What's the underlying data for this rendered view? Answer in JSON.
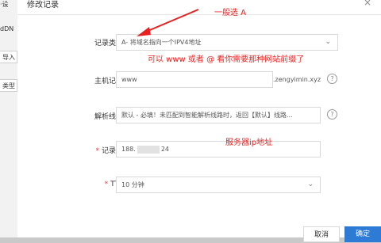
{
  "background": {
    "tabs": [
      "·设",
      "dDN"
    ],
    "buttons": [
      "导入",
      "类型"
    ]
  },
  "dialog": {
    "title": "修改记录",
    "close_glyph": "×"
  },
  "form": {
    "record_type": {
      "label": "记录类型:",
      "value": "A- 将域名指向一个IPV4地址"
    },
    "host": {
      "label": "主机记录:",
      "value": "www",
      "suffix": ".zengyimin.xyz"
    },
    "line": {
      "label": "解析线路:",
      "value": "默认 - 必填！未匹配到智能解析线路时，返回【默认】线路..."
    },
    "record_value": {
      "label": "记录值:",
      "value_start": "188.",
      "value_end": "24"
    },
    "ttl": {
      "label": "TTL:",
      "value": "10 分钟"
    }
  },
  "annotations": {
    "generally_a": "一般选 A",
    "host_note": "可以 www 或者 @  看你需要那种网站前缀了",
    "server_ip": "服务器ip地址"
  },
  "footer": {
    "cancel": "取消",
    "ok": "确定"
  },
  "colors": {
    "annotation": "#e8201f",
    "primary": "#2e7bd6"
  }
}
